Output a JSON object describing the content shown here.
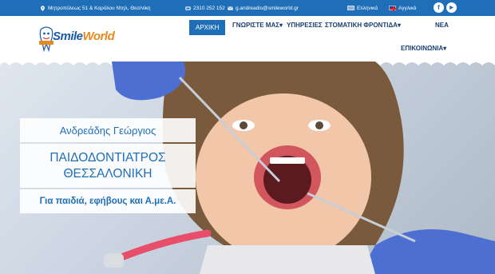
{
  "topbar": {
    "address": "Μητροπόλεως 51 & Καρόλου Ντηλ, Θεσ/νίκη",
    "phone": "2310 252 152",
    "email": "g.andreadis@smileworld.gr",
    "lang_el": "Ελληνικά",
    "lang_en": "Αγγλικά",
    "social_facebook": "f",
    "social_youtube": "▶"
  },
  "brand": {
    "logo_part1": "Smile",
    "logo_part2": "World"
  },
  "nav": {
    "home": "ΑΡΧΙΚΗ",
    "about": "ΓΝΩΡΙΣΤΕ ΜΑΣ",
    "services": "ΥΠΗΡΕΣΙΕΣ",
    "oral_care": "ΣΤΟΜΑΤΙΚΗ ΦΡΟΝΤΙΔΑ",
    "news": "ΝΕΑ",
    "contact": "ΕΠΙΚΟΙΝΩΝΙΑ",
    "dropdown_caret": "▾"
  },
  "hero": {
    "doctor_name": "Ανδρεάδης Γεώργιος",
    "specialty_line1": "ΠΑΙΔΟΔΟΝΤΙΑΤΡΟΣ",
    "specialty_line2": "ΘΕΣΣΑΛΟΝΙΚΗ",
    "tagline": "Για παιδιά, εφήβους και Α.με.Α."
  },
  "colors": {
    "primary": "#1f6fb8",
    "nav_text": "#1a3e74",
    "logo_accent": "#e68a1e",
    "glove": "#4d6fd1"
  },
  "icons": {
    "address": "map-pin-icon",
    "phone": "phone-icon",
    "email": "email-icon",
    "caret": "chevron-down-icon",
    "facebook": "facebook-icon",
    "youtube": "youtube-icon"
  }
}
